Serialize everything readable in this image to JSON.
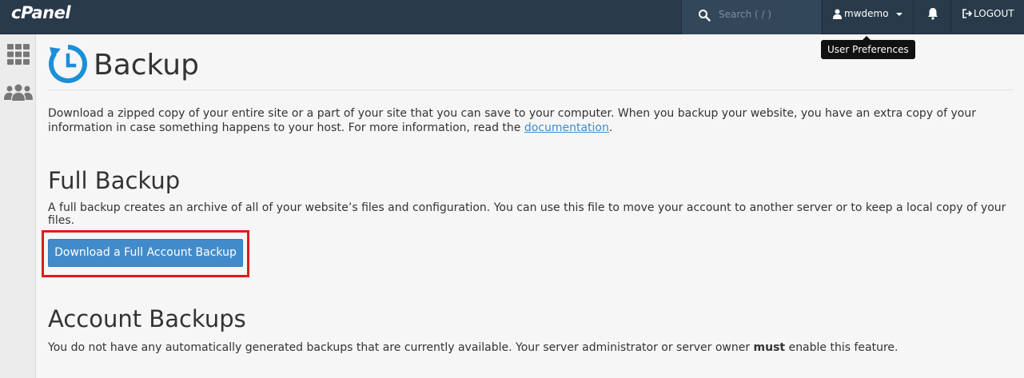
{
  "topbar": {
    "logo": "cPanel",
    "search_placeholder": "Search ( / )",
    "username": "mwdemo",
    "logout_label": "LOGOUT",
    "tooltip": "User Preferences"
  },
  "page": {
    "title": "Backup",
    "intro_text": "Download a zipped copy of your entire site or a part of your site that you can save to your computer. When you backup your website, you have an extra copy of your information in case something happens to your host. For more information, read the ",
    "intro_link": "documentation",
    "intro_end": ".",
    "full_backup": {
      "heading": "Full Backup",
      "description": "A full backup creates an archive of all of your website’s files and configuration. You can use this file to move your account to another server or to keep a local copy of your files.",
      "button_label": "Download a Full Account Backup"
    },
    "account_backups": {
      "heading": "Account Backups",
      "description_start": "You do not have any automatically generated backups that are currently available. Your server administrator or server owner ",
      "description_bold": "must",
      "description_end": " enable this feature."
    }
  },
  "colors": {
    "topbar_bg": "#293a4a",
    "primary_button": "#428bca",
    "highlight_border": "#e21a1a",
    "brand_icon": "#1b8fd8"
  }
}
